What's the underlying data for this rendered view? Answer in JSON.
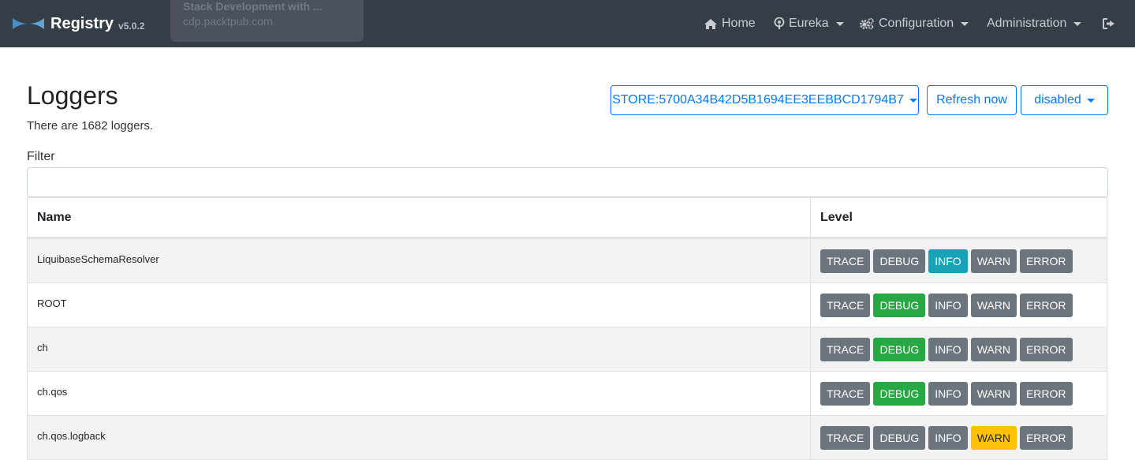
{
  "navbar": {
    "brand": "Registry",
    "version": "v5.0.2",
    "items": [
      {
        "label": "Home",
        "icon": "home-icon"
      },
      {
        "label": "Eureka",
        "icon": "podcast-icon"
      },
      {
        "label": "Configuration",
        "icon": "cogs-icon"
      },
      {
        "label": "Administration",
        "icon": ""
      }
    ],
    "logout_icon": "sign-out-icon"
  },
  "tooltip": {
    "title": "Stack Development with ...",
    "url": "cdp.packtpub.com"
  },
  "page": {
    "title": "Loggers",
    "count_text": "There are 1682 loggers.",
    "instance_select": "STORE:5700A34B42D5B1694EE3EEBBCD1794B7",
    "refresh_label": "Refresh now",
    "auto_refresh": "disabled",
    "filter_label": "Filter",
    "filter_value": ""
  },
  "table": {
    "headers": {
      "name": "Name",
      "level": "Level"
    },
    "level_labels": [
      "TRACE",
      "DEBUG",
      "INFO",
      "WARN",
      "ERROR"
    ],
    "rows": [
      {
        "name": "LiquibaseSchemaResolver",
        "level": "INFO"
      },
      {
        "name": "ROOT",
        "level": "DEBUG"
      },
      {
        "name": "ch",
        "level": "DEBUG"
      },
      {
        "name": "ch.qos",
        "level": "DEBUG"
      },
      {
        "name": "ch.qos.logback",
        "level": "WARN"
      }
    ]
  },
  "colors": {
    "navbar": "#353d47",
    "primary": "#007bff",
    "info": "#17a2b8",
    "debug": "#28a745",
    "warn": "#ffc107",
    "inactive": "#6c757d"
  }
}
